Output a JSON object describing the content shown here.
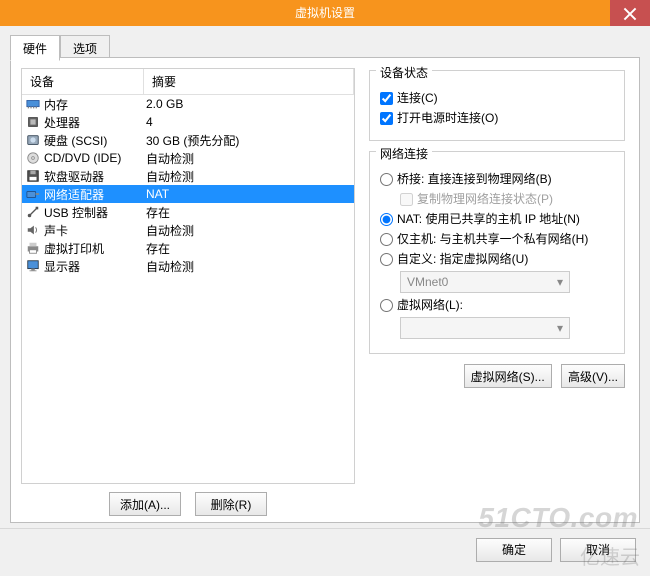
{
  "title": "虚拟机设置",
  "tabs": {
    "hardware": "硬件",
    "options": "选项"
  },
  "columns": {
    "device": "设备",
    "summary": "摘要"
  },
  "devices": [
    {
      "id": "memory",
      "name": "内存",
      "summary": "2.0 GB",
      "icon": "memory"
    },
    {
      "id": "cpu",
      "name": "处理器",
      "summary": "4",
      "icon": "cpu"
    },
    {
      "id": "hdd",
      "name": "硬盘 (SCSI)",
      "summary": "30 GB (预先分配)",
      "icon": "hdd"
    },
    {
      "id": "cddvd",
      "name": "CD/DVD (IDE)",
      "summary": "自动检测",
      "icon": "cd"
    },
    {
      "id": "floppy",
      "name": "软盘驱动器",
      "summary": "自动检测",
      "icon": "floppy"
    },
    {
      "id": "netadapter",
      "name": "网络适配器",
      "summary": "NAT",
      "icon": "net",
      "selected": true
    },
    {
      "id": "usb",
      "name": "USB 控制器",
      "summary": "存在",
      "icon": "usb"
    },
    {
      "id": "sound",
      "name": "声卡",
      "summary": "自动检测",
      "icon": "sound"
    },
    {
      "id": "vprinter",
      "name": "虚拟打印机",
      "summary": "存在",
      "icon": "printer"
    },
    {
      "id": "display",
      "name": "显示器",
      "summary": "自动检测",
      "icon": "display"
    }
  ],
  "buttons": {
    "add": "添加(A)...",
    "remove": "删除(R)",
    "ok": "确定",
    "cancel": "取消",
    "vnet": "虚拟网络(S)...",
    "advanced": "高级(V)..."
  },
  "status": {
    "legend": "设备状态",
    "connected": "连接(C)",
    "connectAtPower": "打开电源时连接(O)"
  },
  "net": {
    "legend": "网络连接",
    "bridged": "桥接: 直接连接到物理网络(B)",
    "replicate": "复制物理网络连接状态(P)",
    "nat": "NAT: 使用已共享的主机 IP 地址(N)",
    "hostonly": "仅主机: 与主机共享一个私有网络(H)",
    "custom": "自定义: 指定虚拟网络(U)",
    "customVal": "VMnet0",
    "vnetwork": "虚拟网络(L):"
  },
  "watermarks": {
    "w1": "51CTO.com",
    "w2": "亿速云"
  }
}
